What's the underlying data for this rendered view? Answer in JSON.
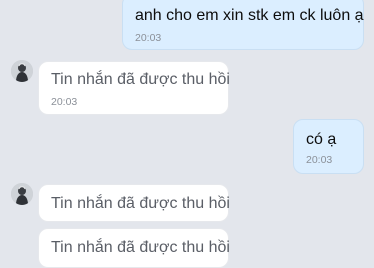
{
  "messages": [
    {
      "direction": "outgoing",
      "text": "anh cho em xin stk em ck luôn ạ",
      "time": "20:03"
    },
    {
      "direction": "incoming",
      "text": "Tin nhắn đã được thu hồi",
      "time": "20:03",
      "recalled": true
    },
    {
      "direction": "outgoing",
      "text": "có ạ",
      "time": "20:03"
    },
    {
      "direction": "incoming",
      "text": "Tin nhắn đã được thu hồi",
      "recalled": true
    },
    {
      "direction": "incoming",
      "text": "Tin nhắn đã được thu hồi",
      "recalled": true
    }
  ],
  "colors": {
    "background": "#e3e6ec",
    "outgoing_bubble": "#dbeeff",
    "incoming_bubble": "#ffffff",
    "timestamp": "#8b9098"
  },
  "icons": {
    "avatar": "user-avatar-icon"
  }
}
